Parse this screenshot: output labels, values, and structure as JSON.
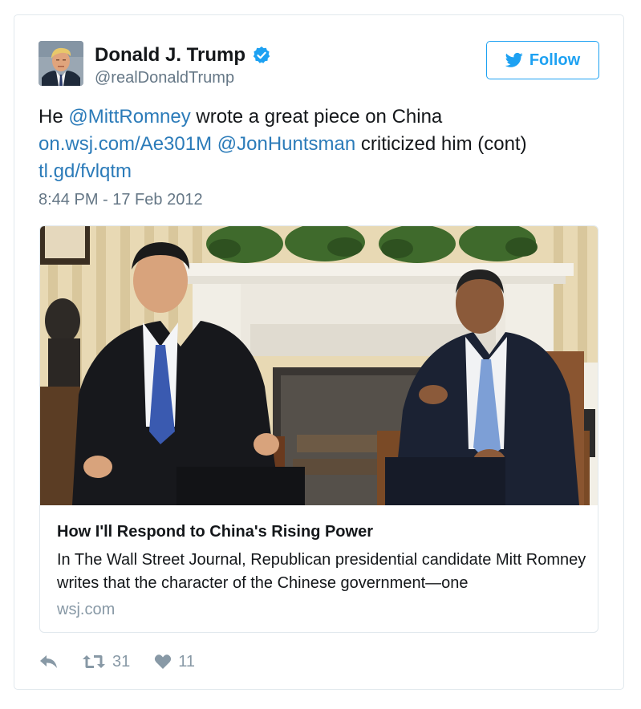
{
  "user": {
    "name": "Donald J. Trump",
    "handle": "@realDonaldTrump",
    "verified": true,
    "avatar_icon": "profile-photo"
  },
  "follow_button": {
    "label": "Follow",
    "icon": "twitter-bird-icon",
    "color": "#1da1f2"
  },
  "tweet": {
    "text_parts": [
      {
        "text": "He ",
        "type": "text"
      },
      {
        "text": "@MittRomney",
        "type": "mention"
      },
      {
        "text": " wrote a great piece on China",
        "type": "text"
      },
      {
        "text": "on.wsj.com/Ae301M",
        "type": "url"
      },
      {
        "text": " ",
        "type": "text"
      },
      {
        "text": "@JonHuntsman",
        "type": "mention"
      },
      {
        "text": " criticized him (cont)",
        "type": "text"
      },
      {
        "text": "tl.gd/fvlqtm",
        "type": "url"
      }
    ],
    "timestamp": "8:44 PM - 17 Feb 2012",
    "link_color": "#2b7bb9"
  },
  "card": {
    "image_icon": "photo-two-men-seated-before-fireplace",
    "title": "How I'll Respond to China's Rising Power",
    "description": "In The Wall Street Journal, Republican presidential candidate Mitt Romney writes that the character of the Chinese government—one",
    "domain": "wsj.com"
  },
  "actions": {
    "reply_icon": "reply-icon",
    "retweet_icon": "retweet-icon",
    "retweet_count": "31",
    "like_icon": "heart-icon",
    "like_count": "11"
  }
}
